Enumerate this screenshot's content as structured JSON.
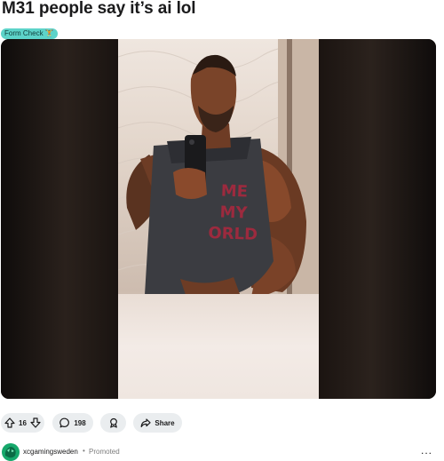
{
  "post": {
    "title": "M31 people say it’s ai lol",
    "flair": "Form Check 🏋️",
    "shirt_text": [
      "ME",
      "MY",
      "ORLD"
    ]
  },
  "actions": {
    "upvote_count": "16",
    "comment_count": "198",
    "share_label": "Share"
  },
  "footer": {
    "advertiser": "xcgamingsweden",
    "separator": "•",
    "promoted_label": "Promoted",
    "more_label": "..."
  },
  "colors": {
    "flair_bg": "#5dd3c9",
    "pill_bg": "#eaedef",
    "avatar_bg": "#16a86b",
    "shirt_text": "#9c2a3e"
  },
  "icons": {
    "upvote": "upvote-arrow-icon",
    "downvote": "downvote-arrow-icon",
    "comment": "comment-bubble-icon",
    "award": "award-icon",
    "share": "share-arrow-icon",
    "more": "more-options-icon"
  }
}
